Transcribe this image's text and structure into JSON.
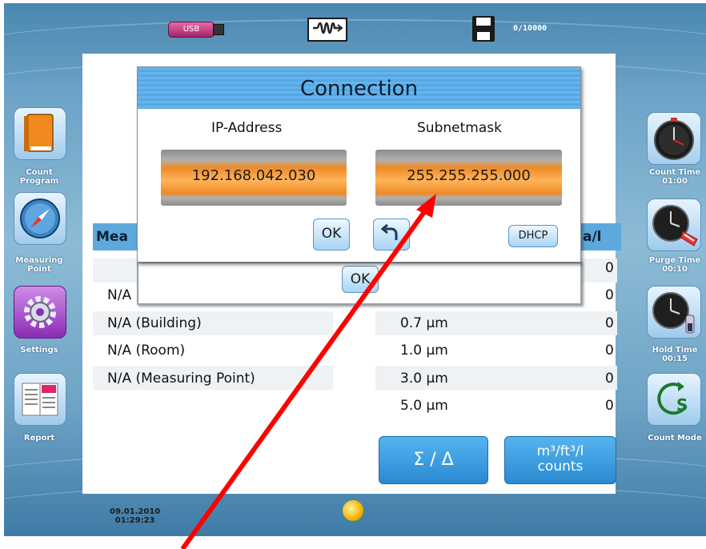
{
  "status_bar": {
    "usb_label": "USB",
    "network_icon": "network-connection-icon",
    "save_icon": "floppy-disk-icon",
    "sample_counter": "0/10000"
  },
  "left_menu": {
    "items": [
      {
        "label_1": "Count",
        "label_2": "Program",
        "icon": "book-icon"
      },
      {
        "label_1": "Measuring",
        "label_2": "Point",
        "icon": "compass-icon"
      },
      {
        "label_1": "Settings",
        "label_2": "",
        "icon": "gear-icon"
      },
      {
        "label_1": "Report",
        "label_2": "",
        "icon": "report-icon"
      }
    ]
  },
  "right_menu": {
    "items": [
      {
        "label": "Count Time",
        "value": "01:00",
        "icon": "stopwatch-icon"
      },
      {
        "label": "Purge Time",
        "value": "00:10",
        "icon": "purge-clock-icon"
      },
      {
        "label": "Hold Time",
        "value": "00:15",
        "icon": "hold-clock-icon"
      },
      {
        "label": "Count Mode",
        "value": "",
        "icon": "count-mode-icon"
      }
    ]
  },
  "table": {
    "header_left": "Mea",
    "header_right": "a/l",
    "rows": [
      {
        "name": "",
        "size": "",
        "count": "0"
      },
      {
        "name": "N/A",
        "size": "",
        "count": "0"
      },
      {
        "name": "N/A (Building)",
        "size": "0.7 µm",
        "count": "0"
      },
      {
        "name": "N/A (Room)",
        "size": "1.0 µm",
        "count": "0"
      },
      {
        "name": "N/A (Measuring Point)",
        "size": "3.0 µm",
        "count": "0"
      },
      {
        "name": "",
        "size": "5.0 µm",
        "count": "0"
      }
    ]
  },
  "bottom_buttons": {
    "sum_delta": "Σ / Δ",
    "units_line1": "m³/ft³/l",
    "units_line2": "counts"
  },
  "footer": {
    "date": "09.01.2010",
    "time": "01:29:23",
    "brightness_icon": "sun-icon"
  },
  "background_dialog": {
    "ok_label": "OK"
  },
  "connection_dialog": {
    "title": "Connection",
    "ip_label": "IP-Address",
    "ip_value": "192.168.042.030",
    "subnet_label": "Subnetmask",
    "subnet_value": "255.255.255.000",
    "ok_label": "OK",
    "back_icon": "back-arrow-icon",
    "dhcp_label": "DHCP"
  },
  "annotation": {
    "arrow_color": "#ff0000"
  }
}
